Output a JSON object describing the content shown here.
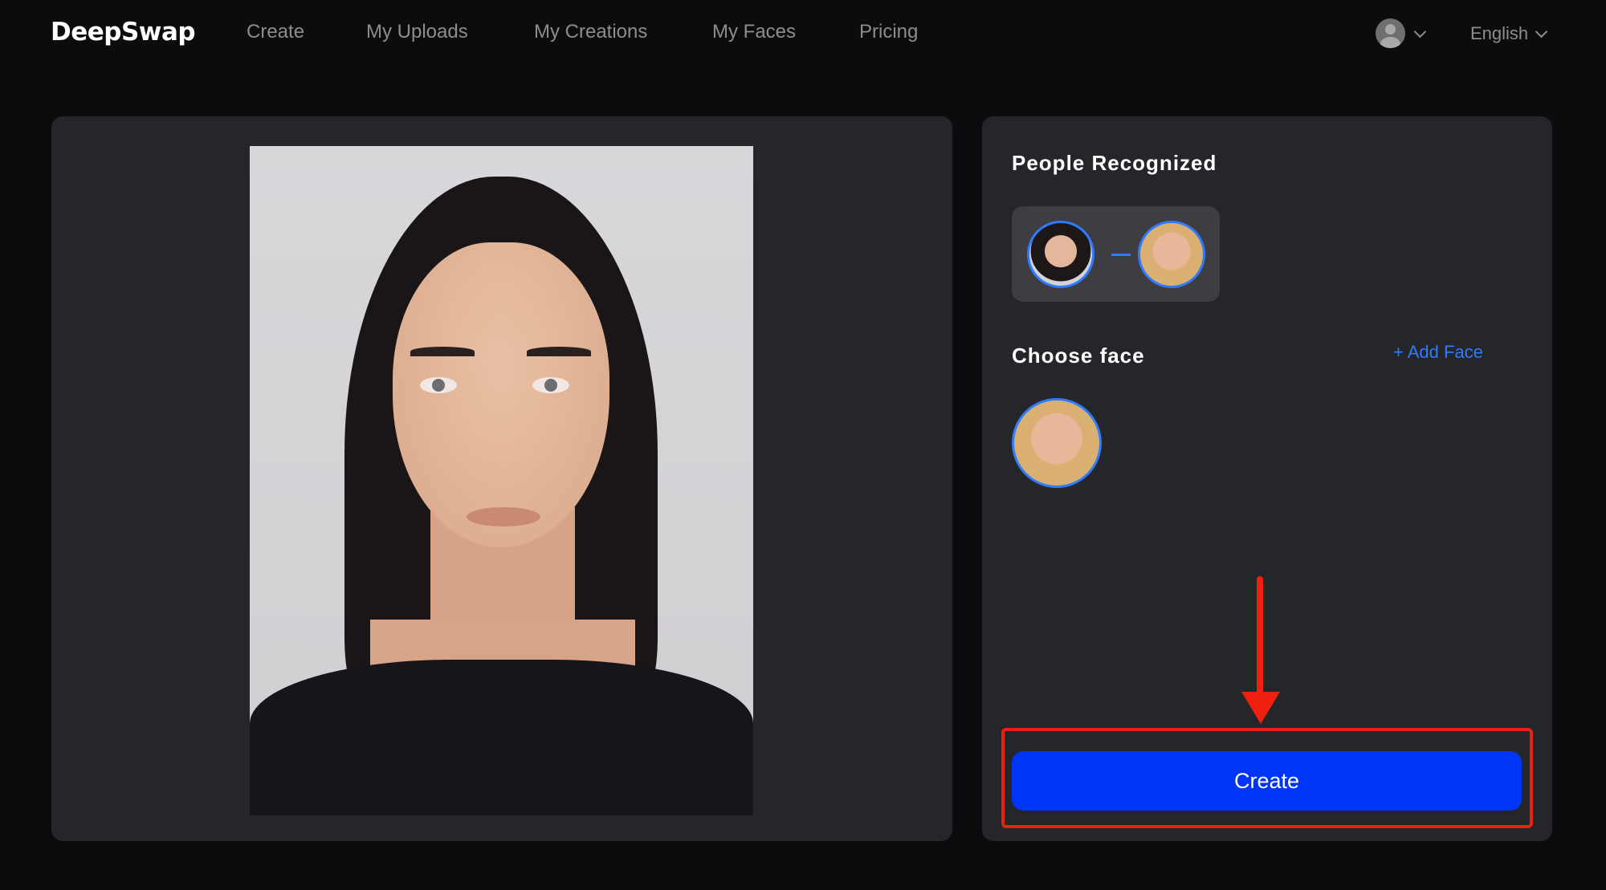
{
  "header": {
    "logo": "DeepSwap",
    "nav": [
      {
        "label": "Create"
      },
      {
        "label": "My Uploads"
      },
      {
        "label": "My Creations"
      },
      {
        "label": "My Faces"
      },
      {
        "label": "Pricing"
      }
    ],
    "language": "English"
  },
  "preview": {
    "image_description": "Portrait photo of a woman with long dark hair, black top, light gray background"
  },
  "sidebar": {
    "people_recognized_title": "People Recognized",
    "recognized_pair": {
      "source": "detected-face",
      "target": "chosen-face"
    },
    "choose_face_title": "Choose face",
    "add_face_label": "+ Add Face",
    "faces": [
      {
        "name": "face-1"
      }
    ],
    "create_label": "Create"
  },
  "annotation": {
    "color": "#f02010",
    "target": "create-button"
  },
  "colors": {
    "accent": "#2f7bff",
    "button": "#0035f5",
    "panel": "#252629",
    "background": "#0b0c0e"
  }
}
